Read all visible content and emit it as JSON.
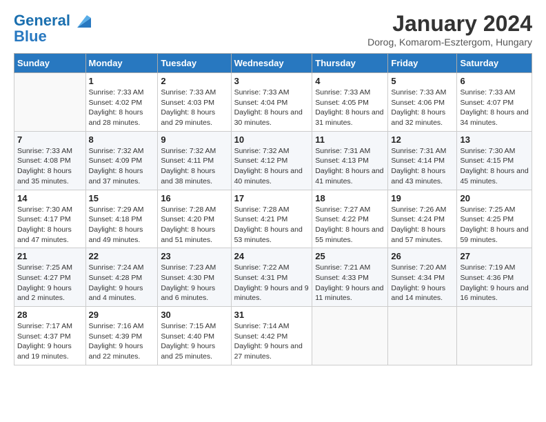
{
  "logo": {
    "line1": "General",
    "line2": "Blue"
  },
  "header": {
    "title": "January 2024",
    "subtitle": "Dorog, Komarom-Esztergom, Hungary"
  },
  "weekdays": [
    "Sunday",
    "Monday",
    "Tuesday",
    "Wednesday",
    "Thursday",
    "Friday",
    "Saturday"
  ],
  "weeks": [
    [
      {
        "day": "",
        "sunrise": "",
        "sunset": "",
        "daylight": ""
      },
      {
        "day": "1",
        "sunrise": "Sunrise: 7:33 AM",
        "sunset": "Sunset: 4:02 PM",
        "daylight": "Daylight: 8 hours and 28 minutes."
      },
      {
        "day": "2",
        "sunrise": "Sunrise: 7:33 AM",
        "sunset": "Sunset: 4:03 PM",
        "daylight": "Daylight: 8 hours and 29 minutes."
      },
      {
        "day": "3",
        "sunrise": "Sunrise: 7:33 AM",
        "sunset": "Sunset: 4:04 PM",
        "daylight": "Daylight: 8 hours and 30 minutes."
      },
      {
        "day": "4",
        "sunrise": "Sunrise: 7:33 AM",
        "sunset": "Sunset: 4:05 PM",
        "daylight": "Daylight: 8 hours and 31 minutes."
      },
      {
        "day": "5",
        "sunrise": "Sunrise: 7:33 AM",
        "sunset": "Sunset: 4:06 PM",
        "daylight": "Daylight: 8 hours and 32 minutes."
      },
      {
        "day": "6",
        "sunrise": "Sunrise: 7:33 AM",
        "sunset": "Sunset: 4:07 PM",
        "daylight": "Daylight: 8 hours and 34 minutes."
      }
    ],
    [
      {
        "day": "7",
        "sunrise": "Sunrise: 7:33 AM",
        "sunset": "Sunset: 4:08 PM",
        "daylight": "Daylight: 8 hours and 35 minutes."
      },
      {
        "day": "8",
        "sunrise": "Sunrise: 7:32 AM",
        "sunset": "Sunset: 4:09 PM",
        "daylight": "Daylight: 8 hours and 37 minutes."
      },
      {
        "day": "9",
        "sunrise": "Sunrise: 7:32 AM",
        "sunset": "Sunset: 4:11 PM",
        "daylight": "Daylight: 8 hours and 38 minutes."
      },
      {
        "day": "10",
        "sunrise": "Sunrise: 7:32 AM",
        "sunset": "Sunset: 4:12 PM",
        "daylight": "Daylight: 8 hours and 40 minutes."
      },
      {
        "day": "11",
        "sunrise": "Sunrise: 7:31 AM",
        "sunset": "Sunset: 4:13 PM",
        "daylight": "Daylight: 8 hours and 41 minutes."
      },
      {
        "day": "12",
        "sunrise": "Sunrise: 7:31 AM",
        "sunset": "Sunset: 4:14 PM",
        "daylight": "Daylight: 8 hours and 43 minutes."
      },
      {
        "day": "13",
        "sunrise": "Sunrise: 7:30 AM",
        "sunset": "Sunset: 4:15 PM",
        "daylight": "Daylight: 8 hours and 45 minutes."
      }
    ],
    [
      {
        "day": "14",
        "sunrise": "Sunrise: 7:30 AM",
        "sunset": "Sunset: 4:17 PM",
        "daylight": "Daylight: 8 hours and 47 minutes."
      },
      {
        "day": "15",
        "sunrise": "Sunrise: 7:29 AM",
        "sunset": "Sunset: 4:18 PM",
        "daylight": "Daylight: 8 hours and 49 minutes."
      },
      {
        "day": "16",
        "sunrise": "Sunrise: 7:28 AM",
        "sunset": "Sunset: 4:20 PM",
        "daylight": "Daylight: 8 hours and 51 minutes."
      },
      {
        "day": "17",
        "sunrise": "Sunrise: 7:28 AM",
        "sunset": "Sunset: 4:21 PM",
        "daylight": "Daylight: 8 hours and 53 minutes."
      },
      {
        "day": "18",
        "sunrise": "Sunrise: 7:27 AM",
        "sunset": "Sunset: 4:22 PM",
        "daylight": "Daylight: 8 hours and 55 minutes."
      },
      {
        "day": "19",
        "sunrise": "Sunrise: 7:26 AM",
        "sunset": "Sunset: 4:24 PM",
        "daylight": "Daylight: 8 hours and 57 minutes."
      },
      {
        "day": "20",
        "sunrise": "Sunrise: 7:25 AM",
        "sunset": "Sunset: 4:25 PM",
        "daylight": "Daylight: 8 hours and 59 minutes."
      }
    ],
    [
      {
        "day": "21",
        "sunrise": "Sunrise: 7:25 AM",
        "sunset": "Sunset: 4:27 PM",
        "daylight": "Daylight: 9 hours and 2 minutes."
      },
      {
        "day": "22",
        "sunrise": "Sunrise: 7:24 AM",
        "sunset": "Sunset: 4:28 PM",
        "daylight": "Daylight: 9 hours and 4 minutes."
      },
      {
        "day": "23",
        "sunrise": "Sunrise: 7:23 AM",
        "sunset": "Sunset: 4:30 PM",
        "daylight": "Daylight: 9 hours and 6 minutes."
      },
      {
        "day": "24",
        "sunrise": "Sunrise: 7:22 AM",
        "sunset": "Sunset: 4:31 PM",
        "daylight": "Daylight: 9 hours and 9 minutes."
      },
      {
        "day": "25",
        "sunrise": "Sunrise: 7:21 AM",
        "sunset": "Sunset: 4:33 PM",
        "daylight": "Daylight: 9 hours and 11 minutes."
      },
      {
        "day": "26",
        "sunrise": "Sunrise: 7:20 AM",
        "sunset": "Sunset: 4:34 PM",
        "daylight": "Daylight: 9 hours and 14 minutes."
      },
      {
        "day": "27",
        "sunrise": "Sunrise: 7:19 AM",
        "sunset": "Sunset: 4:36 PM",
        "daylight": "Daylight: 9 hours and 16 minutes."
      }
    ],
    [
      {
        "day": "28",
        "sunrise": "Sunrise: 7:17 AM",
        "sunset": "Sunset: 4:37 PM",
        "daylight": "Daylight: 9 hours and 19 minutes."
      },
      {
        "day": "29",
        "sunrise": "Sunrise: 7:16 AM",
        "sunset": "Sunset: 4:39 PM",
        "daylight": "Daylight: 9 hours and 22 minutes."
      },
      {
        "day": "30",
        "sunrise": "Sunrise: 7:15 AM",
        "sunset": "Sunset: 4:40 PM",
        "daylight": "Daylight: 9 hours and 25 minutes."
      },
      {
        "day": "31",
        "sunrise": "Sunrise: 7:14 AM",
        "sunset": "Sunset: 4:42 PM",
        "daylight": "Daylight: 9 hours and 27 minutes."
      },
      {
        "day": "",
        "sunrise": "",
        "sunset": "",
        "daylight": ""
      },
      {
        "day": "",
        "sunrise": "",
        "sunset": "",
        "daylight": ""
      },
      {
        "day": "",
        "sunrise": "",
        "sunset": "",
        "daylight": ""
      }
    ]
  ]
}
